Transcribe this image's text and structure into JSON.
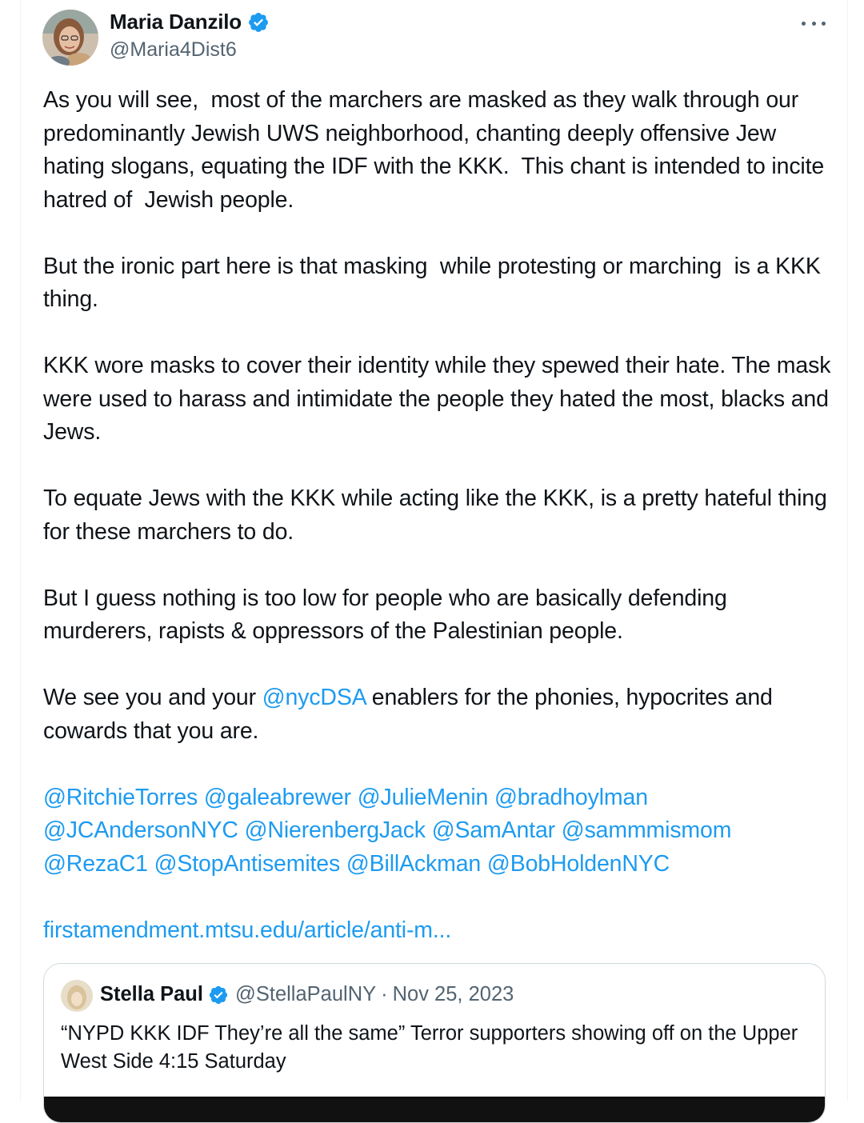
{
  "author": {
    "display_name": "Maria Danzilo",
    "handle": "@Maria4Dist6",
    "verified": true,
    "avatar_icon": "profile-photo-avatar"
  },
  "more_icon": "more-options-icon",
  "paragraphs": [
    [
      {
        "t": "As you will see,  most of the marchers are masked as they walk through our predominantly Jewish UWS neighborhood, chanting deeply offensive Jew hating slogans, equating the IDF with the KKK.  This chant is intended to incite hatred of  Jewish people."
      }
    ],
    [
      {
        "t": "But the ironic part here is that masking  while protesting or marching  is a KKK thing."
      }
    ],
    [
      {
        "t": "KKK wore masks to cover their identity while they spewed their hate. The mask were used to harass and intimidate the people they hated the most, blacks and Jews."
      }
    ],
    [
      {
        "t": "To equate Jews with the KKK while acting like the KKK, is a pretty hateful thing for these marchers to do."
      }
    ],
    [
      {
        "t": "But I guess nothing is too low for people who are basically defending murderers, rapists & oppressors of the Palestinian people."
      }
    ],
    [
      {
        "t": "We see you and your "
      },
      {
        "t": "@nycDSA",
        "link": true
      },
      {
        "t": " enablers for the phonies, hypocrites and cowards that you are."
      }
    ],
    [
      {
        "t": "@RitchieTorres",
        "link": true
      },
      {
        "t": " "
      },
      {
        "t": "@galeabrewer",
        "link": true
      },
      {
        "t": " "
      },
      {
        "t": "@JulieMenin",
        "link": true
      },
      {
        "t": " "
      },
      {
        "t": "@bradhoylman",
        "link": true
      },
      {
        "t": " "
      },
      {
        "t": "@JCAndersonNYC",
        "link": true
      },
      {
        "t": " "
      },
      {
        "t": "@NierenbergJack",
        "link": true
      },
      {
        "t": " "
      },
      {
        "t": "@SamAntar",
        "link": true
      },
      {
        "t": " "
      },
      {
        "t": "@sammmismom",
        "link": true
      },
      {
        "t": " "
      },
      {
        "t": "@RezaC1",
        "link": true
      },
      {
        "t": " "
      },
      {
        "t": "@StopAntisemites",
        "link": true
      },
      {
        "t": " "
      },
      {
        "t": "@BillAckman",
        "link": true
      },
      {
        "t": " "
      },
      {
        "t": "@BobHoldenNYC",
        "link": true
      }
    ],
    [
      {
        "t": "firstamendment.mtsu.edu/article/anti-m...",
        "link": true
      }
    ]
  ],
  "quoted_tweet": {
    "display_name": "Stella Paul",
    "handle": "@StellaPaulNY",
    "separator": "·",
    "date": "Nov 25, 2023",
    "verified": true,
    "text": "“NYPD KKK IDF They’re all the same” Terror supporters showing off on the Upper West Side 4:15 Saturday"
  },
  "colors": {
    "link": "#1d9bf0",
    "verified_badge": "#1d9bf0",
    "secondary_text": "#536471",
    "primary_text": "#0f1419",
    "border": "#cfd9de"
  }
}
